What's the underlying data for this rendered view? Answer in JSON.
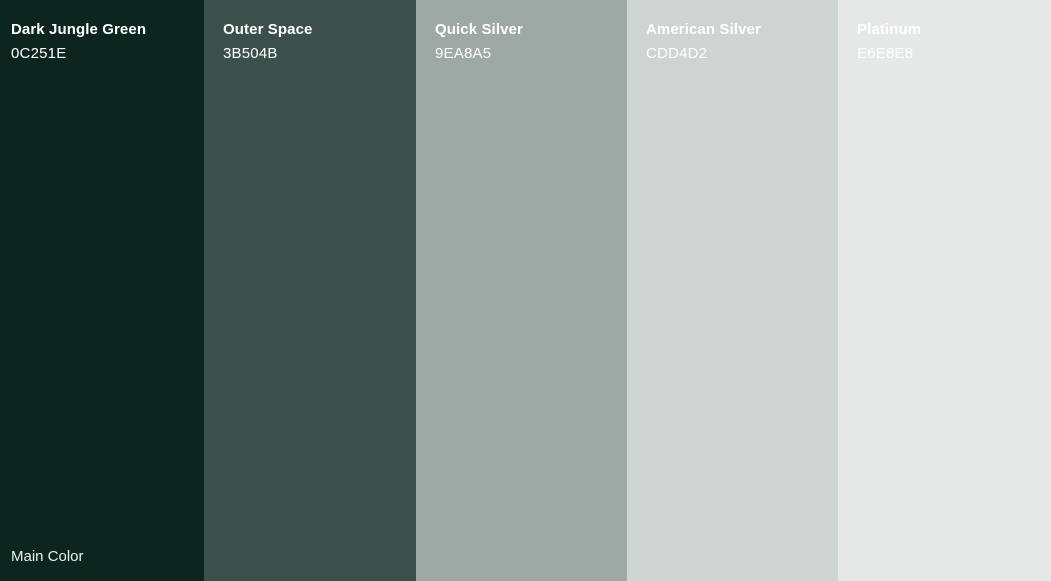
{
  "palette": {
    "swatches": [
      {
        "name": "Dark Jungle Green",
        "hex": "0C251E",
        "color": "#0C251E"
      },
      {
        "name": "Outer Space",
        "hex": "3B504B",
        "color": "#3B504B"
      },
      {
        "name": "Quick Silver",
        "hex": "9EA8A5",
        "color": "#9EA8A5"
      },
      {
        "name": "American Silver",
        "hex": "CDD4D2",
        "color": "#CDD4D2"
      },
      {
        "name": "Platinum",
        "hex": "E6E8E8",
        "color": "#E6E8E8"
      }
    ],
    "main_color_label": "Main Color"
  }
}
